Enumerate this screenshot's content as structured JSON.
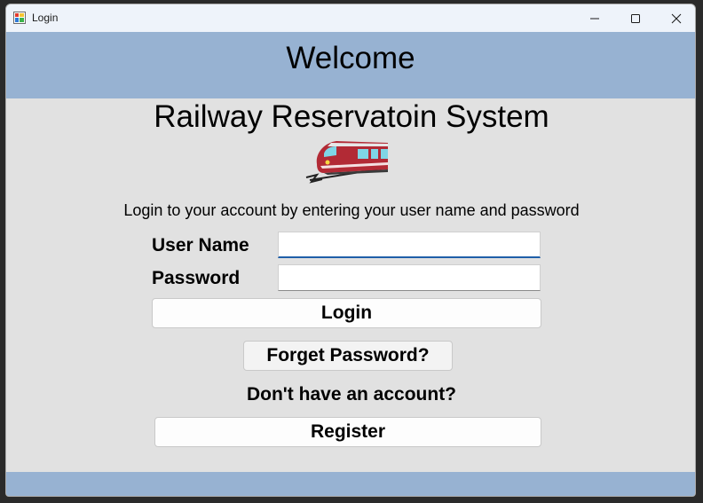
{
  "window": {
    "title": "Login",
    "icon": "app-form-icon",
    "controls": [
      "minimize-icon",
      "maximize-icon",
      "close-icon"
    ]
  },
  "header": {
    "welcome": "Welcome"
  },
  "main": {
    "system_title": "Railway Reservatoin System",
    "logo_icon": "train-icon",
    "instructions": "Login to your account by entering your user name and password",
    "username_label": "User Name",
    "username_value": "",
    "password_label": "Password",
    "password_value": "",
    "login_button": "Login",
    "forgot_button": "Forget Password?",
    "no_account_text": "Don't have an account?",
    "register_button": "Register"
  },
  "colors": {
    "header_band": "#97b2d2",
    "background": "#e1e1e1",
    "focus_underline": "#1f5fa8",
    "train_body": "#b22a35",
    "train_windows": "#7fd6e6"
  }
}
